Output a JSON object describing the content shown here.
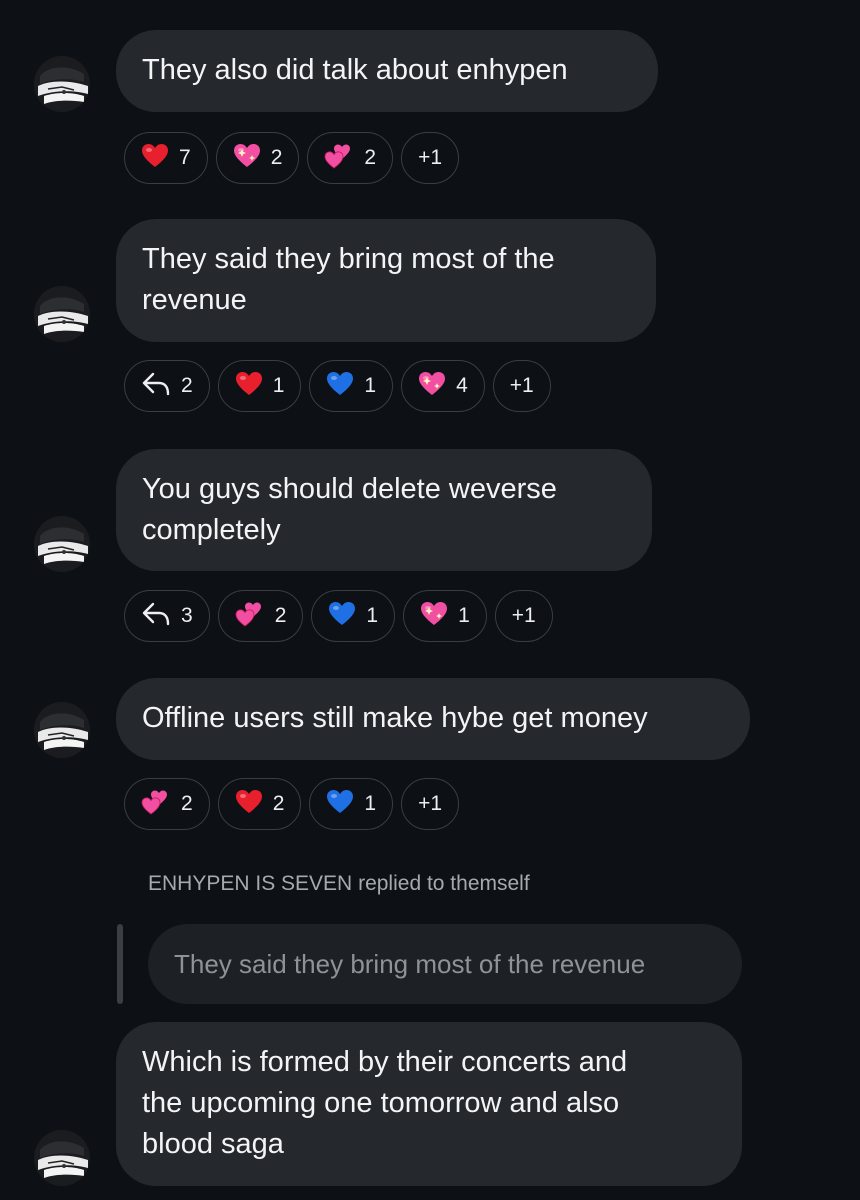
{
  "messages": [
    {
      "text": "They also did talk about enhypen",
      "reactions": [
        {
          "icon": "red-heart",
          "count": "7"
        },
        {
          "icon": "sparkling-heart",
          "count": "2"
        },
        {
          "icon": "two-hearts",
          "count": "2"
        },
        {
          "icon": "more",
          "count": "+1"
        }
      ]
    },
    {
      "text": "They said they bring most of the\nrevenue",
      "reactions": [
        {
          "icon": "reply-arrow",
          "count": "2"
        },
        {
          "icon": "red-heart",
          "count": "1"
        },
        {
          "icon": "blue-heart",
          "count": "1"
        },
        {
          "icon": "sparkling-heart",
          "count": "4"
        },
        {
          "icon": "more",
          "count": "+1"
        }
      ]
    },
    {
      "text": "You guys should delete weverse\ncompletely",
      "reactions": [
        {
          "icon": "reply-arrow",
          "count": "3"
        },
        {
          "icon": "two-hearts",
          "count": "2"
        },
        {
          "icon": "blue-heart",
          "count": "1"
        },
        {
          "icon": "sparkling-heart",
          "count": "1"
        },
        {
          "icon": "more",
          "count": "+1"
        }
      ]
    },
    {
      "text": "Offline users still make hybe get money",
      "reactions": [
        {
          "icon": "two-hearts",
          "count": "2"
        },
        {
          "icon": "red-heart",
          "count": "2"
        },
        {
          "icon": "blue-heart",
          "count": "1"
        },
        {
          "icon": "more",
          "count": "+1"
        }
      ]
    }
  ],
  "reply": {
    "author": "ENHYPEN IS SEVEN",
    "action": "replied to themself",
    "quoted_text": "They said they bring most of the revenue",
    "text": "Which is formed by their concerts and\nthe upcoming one tomorrow and also\nblood saga"
  },
  "colors": {
    "background": "#0d1014",
    "bubble": "#25282d",
    "quoted_bubble": "#1d2024",
    "red_heart": "#e8202e",
    "blue_heart": "#1f6fe5",
    "pink_heart": "#f24fa3"
  }
}
